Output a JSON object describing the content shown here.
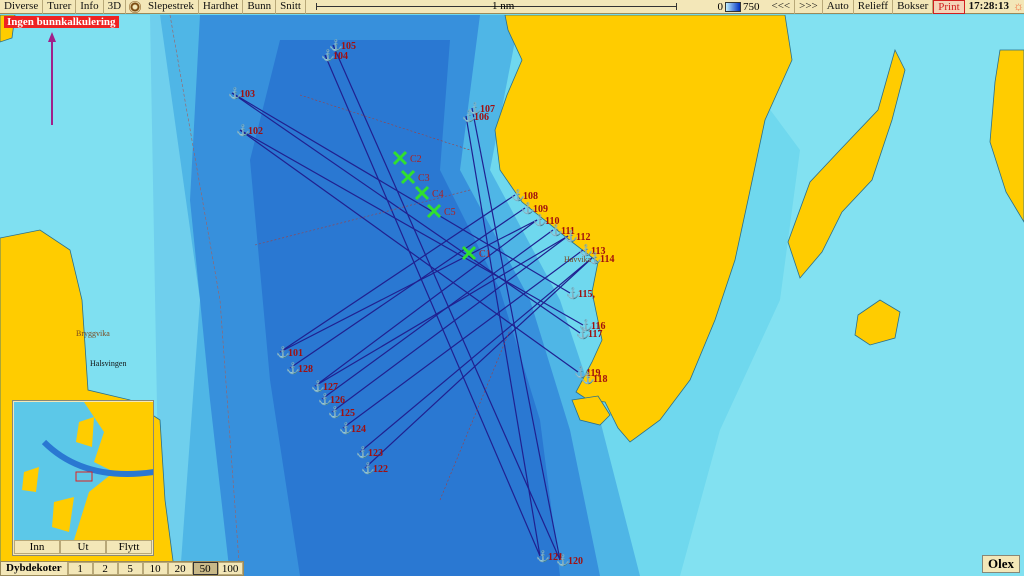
{
  "menu": {
    "items": [
      "Diverse",
      "Turer",
      "Info",
      "3D"
    ],
    "items2": [
      "Slepestrek",
      "Hardhet",
      "Bunn",
      "Snitt"
    ]
  },
  "scale": {
    "label": "1 nm"
  },
  "depth_scale": {
    "min": "0",
    "max": "750"
  },
  "right_buttons": [
    "<<<",
    ">>>",
    "Auto",
    "Relieff",
    "Bokser"
  ],
  "print_label": "Print",
  "clock": "17:28:13",
  "warning": "Ingen bunnkalkulering",
  "colors": {
    "land": "#ffcc00",
    "deep": "#1f6fd0",
    "shallow": "#8fe8f4",
    "track": "#202090",
    "marker": "#30e030",
    "label": "#a01010"
  },
  "markers": [
    "105",
    "104",
    "103",
    "102",
    "107",
    "106",
    "108",
    "109",
    "110",
    "111",
    "112",
    "113",
    "114",
    "115,",
    "116",
    "117",
    "119",
    "118",
    "101",
    "128",
    "127",
    "126",
    "125",
    "124",
    "123",
    "122",
    "121",
    "120"
  ],
  "crosses": [
    "C2",
    "C3",
    "C4",
    "C5",
    "C1"
  ],
  "places": [
    "Bryggvika",
    "Halsvingen",
    "Havvika"
  ],
  "inset": {
    "buttons": [
      "Inn",
      "Ut",
      "Flytt"
    ]
  },
  "dybdekoter": {
    "label": "Dybdekoter",
    "values": [
      "1",
      "2",
      "5",
      "10",
      "20",
      "50",
      "100"
    ],
    "selected": "50"
  },
  "brand": "Olex"
}
